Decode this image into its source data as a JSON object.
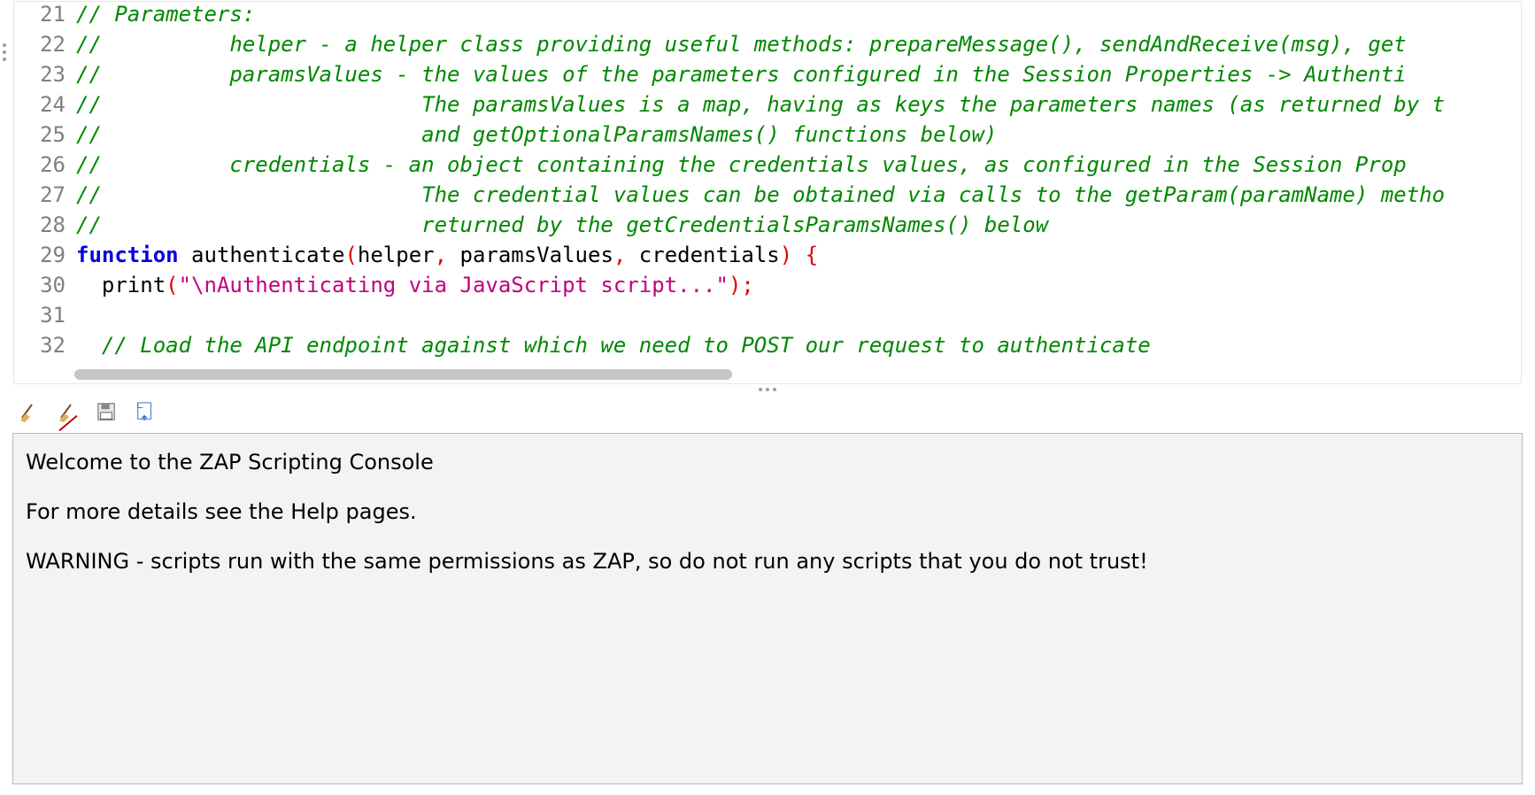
{
  "editor": {
    "first_line_number": 21,
    "lines": [
      {
        "n": 21,
        "tokens": [
          {
            "c": "cmt",
            "t": "// Parameters:"
          }
        ]
      },
      {
        "n": 22,
        "tokens": [
          {
            "c": "cmt",
            "t": "//          helper - a helper class providing useful methods: prepareMessage(), sendAndReceive(msg), get"
          }
        ]
      },
      {
        "n": 23,
        "tokens": [
          {
            "c": "cmt",
            "t": "//          paramsValues - the values of the parameters configured in the Session Properties -> Authenti"
          }
        ]
      },
      {
        "n": 24,
        "tokens": [
          {
            "c": "cmt",
            "t": "//                         The paramsValues is a map, having as keys the parameters names (as returned by t"
          }
        ]
      },
      {
        "n": 25,
        "tokens": [
          {
            "c": "cmt",
            "t": "//                         and getOptionalParamsNames() functions below)"
          }
        ]
      },
      {
        "n": 26,
        "tokens": [
          {
            "c": "cmt",
            "t": "//          credentials - an object containing the credentials values, as configured in the Session Prop"
          }
        ]
      },
      {
        "n": 27,
        "tokens": [
          {
            "c": "cmt",
            "t": "//                         The credential values can be obtained via calls to the getParam(paramName) metho"
          }
        ]
      },
      {
        "n": 28,
        "tokens": [
          {
            "c": "cmt",
            "t": "//                         returned by the getCredentialsParamsNames() below"
          }
        ]
      },
      {
        "n": 29,
        "tokens": [
          {
            "c": "kw",
            "t": "function"
          },
          {
            "c": "fn",
            "t": " authenticate"
          },
          {
            "c": "pn",
            "t": "("
          },
          {
            "c": "fn",
            "t": "helper"
          },
          {
            "c": "pn",
            "t": ","
          },
          {
            "c": "fn",
            "t": " paramsValues"
          },
          {
            "c": "pn",
            "t": ","
          },
          {
            "c": "fn",
            "t": " credentials"
          },
          {
            "c": "pn",
            "t": ")"
          },
          {
            "c": "fn",
            "t": " "
          },
          {
            "c": "pn",
            "t": "{"
          }
        ]
      },
      {
        "n": 30,
        "tokens": [
          {
            "c": "fn",
            "t": "  print"
          },
          {
            "c": "pn",
            "t": "("
          },
          {
            "c": "str",
            "t": "\"\\nAuthenticating via JavaScript script...\""
          },
          {
            "c": "pn",
            "t": ")"
          },
          {
            "c": "pn",
            "t": ";"
          }
        ]
      },
      {
        "n": 31,
        "tokens": [
          {
            "c": "fn",
            "t": ""
          }
        ]
      },
      {
        "n": 32,
        "tokens": [
          {
            "c": "cmt",
            "t": "  // Load the API endpoint against which we need to POST our request to authenticate"
          }
        ]
      }
    ]
  },
  "toolbar": {
    "buttons": [
      {
        "name": "clear-console-button",
        "icon": "broom-icon"
      },
      {
        "name": "clear-on-run-toggle",
        "icon": "broom-strike-icon"
      },
      {
        "name": "save-output-button",
        "icon": "floppy-icon"
      },
      {
        "name": "export-output-button",
        "icon": "page-export-icon"
      }
    ]
  },
  "console": {
    "lines": [
      "Welcome to the ZAP Scripting Console",
      "For more details see the Help pages.",
      "WARNING - scripts run with the same permissions as ZAP, so do not run any scripts that you do not trust!"
    ]
  }
}
